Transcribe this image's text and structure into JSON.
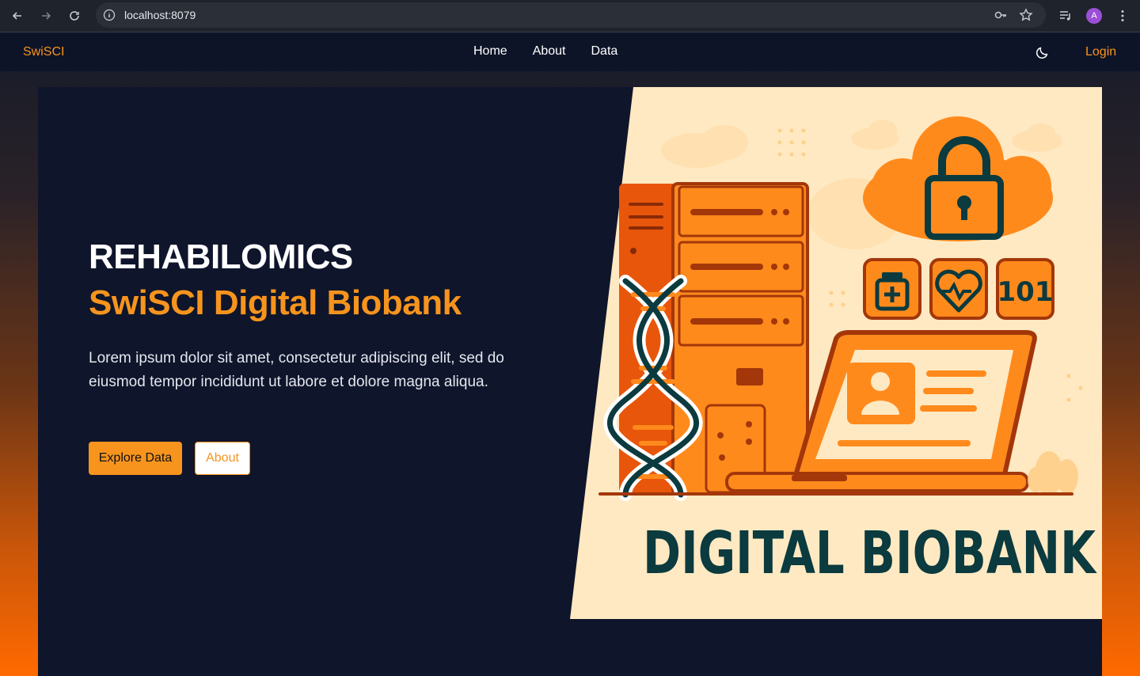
{
  "browser": {
    "url": "localhost:8079",
    "profile_initial": "A",
    "icons": {
      "back": "arrow-left-icon",
      "forward": "arrow-right-icon",
      "reload": "reload-icon",
      "site_info": "info-icon",
      "password": "key-icon",
      "bookmark": "star-icon",
      "media": "playlist-icon",
      "menu": "kebab-menu-icon"
    }
  },
  "navbar": {
    "brand": "SwiSCI",
    "links": [
      "Home",
      "About",
      "Data"
    ],
    "login": "Login",
    "theme_icon": "moon-icon"
  },
  "hero": {
    "title": "REHABILOMICS",
    "subtitle": "SwiSCI Digital Biobank",
    "description": "Lorem ipsum dolor sit amet, consectetur adipiscing elit, sed do eiusmod tempor incididunt ut labore et dolore magna aliqua.",
    "primary_button": "Explore Data",
    "secondary_button": "About"
  },
  "illustration": {
    "caption": "DIGITAL BIOBANK",
    "badge_number": "101"
  },
  "colors": {
    "accent": "#f7941d",
    "page_dark": "#0f152b",
    "illustration_bg": "#ffe9c2",
    "illustration_ink": "#0b3a3f"
  }
}
